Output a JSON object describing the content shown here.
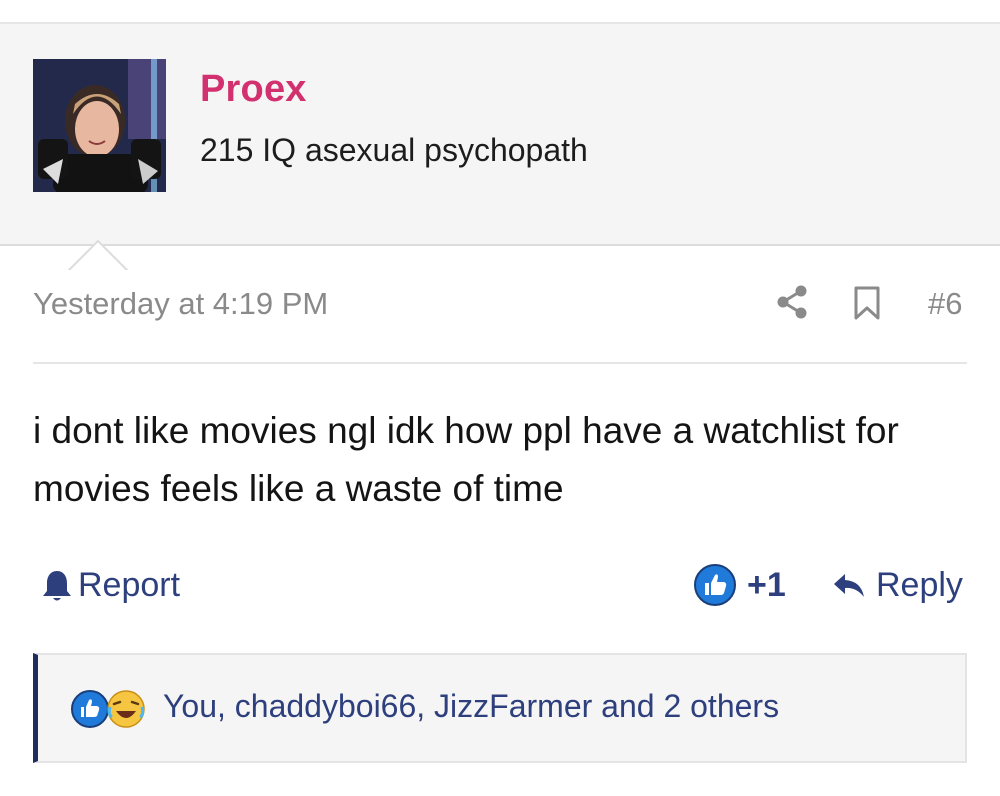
{
  "user": {
    "name": "Proex",
    "title": "215 IQ asexual psychopath",
    "avatar_icon": "user-avatar-photo"
  },
  "post": {
    "timestamp": "Yesterday at 4:19 PM",
    "number": "#6",
    "body": "i dont like movies ngl idk how ppl have a watchlist for movies feels like a waste of time",
    "share_icon": "share-icon",
    "bookmark_icon": "bookmark-icon"
  },
  "actions": {
    "report_label": "Report",
    "report_icon": "bell-icon",
    "like_count": "+1",
    "like_icon": "thumbs-up-icon",
    "reply_label": "Reply",
    "reply_icon": "reply-arrow-icon"
  },
  "reactions": {
    "summary": "You, chaddyboi66, JizzFarmer and 2 others",
    "icons": [
      "thumbs-up-icon",
      "laughing-face-icon"
    ]
  },
  "colors": {
    "username": "#d2306e",
    "link": "#2d3f7d",
    "muted": "#8a8a8a",
    "accent_bar": "#1f2d5c",
    "like_blue": "#1f7ad9"
  }
}
